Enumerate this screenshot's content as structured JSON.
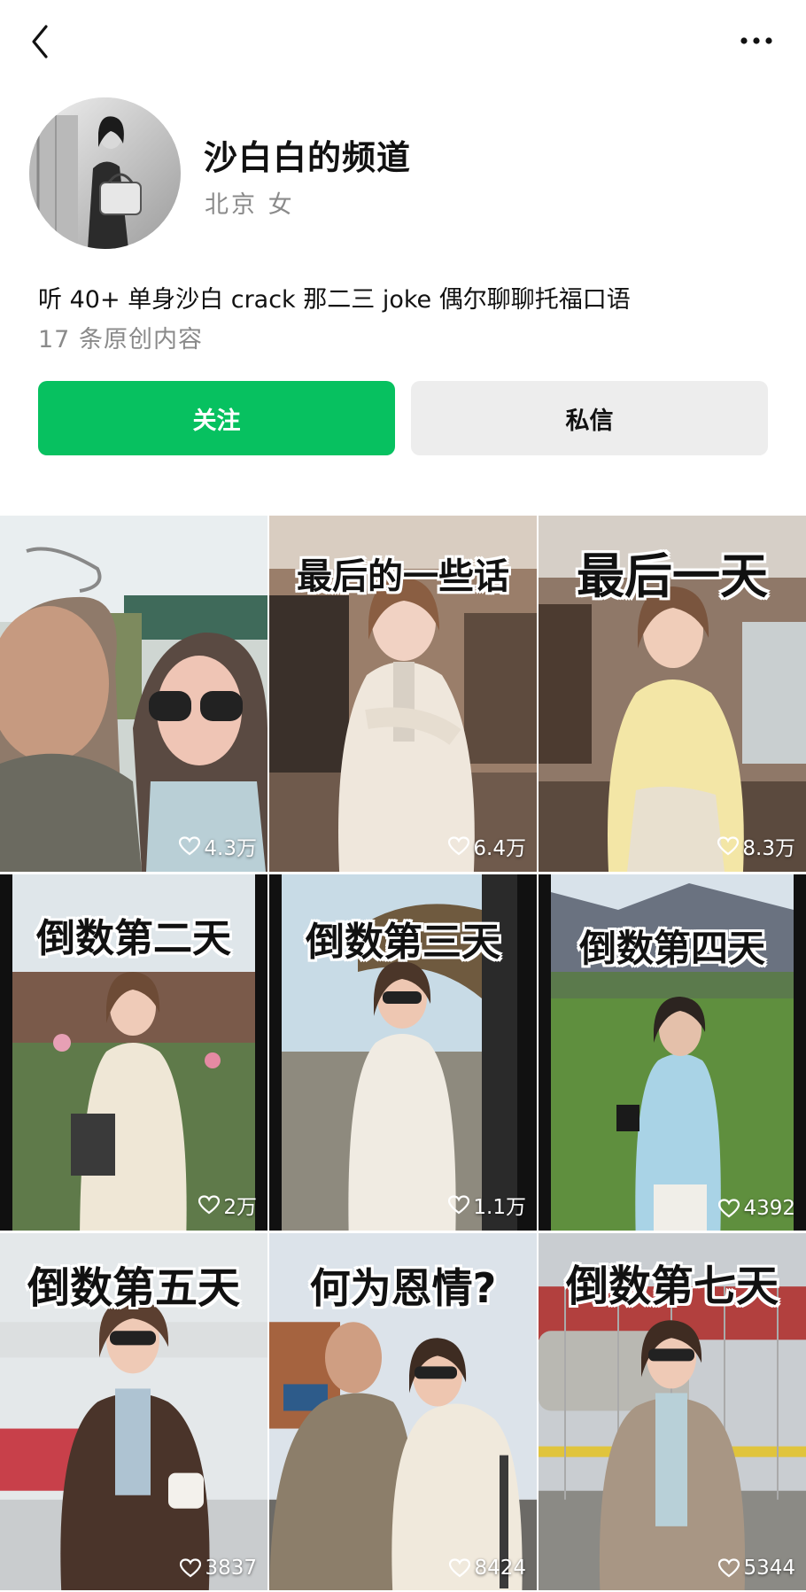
{
  "header": {
    "back_icon": "chevron-left-icon",
    "more_icon": "more-horizontal-icon"
  },
  "profile": {
    "name": "沙白白的频道",
    "meta": "北京 女",
    "bio": "听 40+ 单身沙白 crack 那二三 joke 偶尔聊聊托福口语",
    "count": "17 条原创内容"
  },
  "actions": {
    "follow_label": "关注",
    "message_label": "私信",
    "follow_color": "#07c160"
  },
  "videos": [
    {
      "caption": "",
      "likes": "4.3万"
    },
    {
      "caption": "最后的一些话",
      "likes": "6.4万"
    },
    {
      "caption": "最后一天",
      "likes": "8.3万"
    },
    {
      "caption": "倒数第二天",
      "likes": "2万"
    },
    {
      "caption": "倒数第三天",
      "likes": "1.1万"
    },
    {
      "caption": "倒数第四天",
      "likes": "4392"
    },
    {
      "caption": "倒数第五天",
      "likes": "3837"
    },
    {
      "caption": "何为恩情?",
      "likes": "8424"
    },
    {
      "caption": "倒数第七天",
      "likes": "5344"
    }
  ]
}
